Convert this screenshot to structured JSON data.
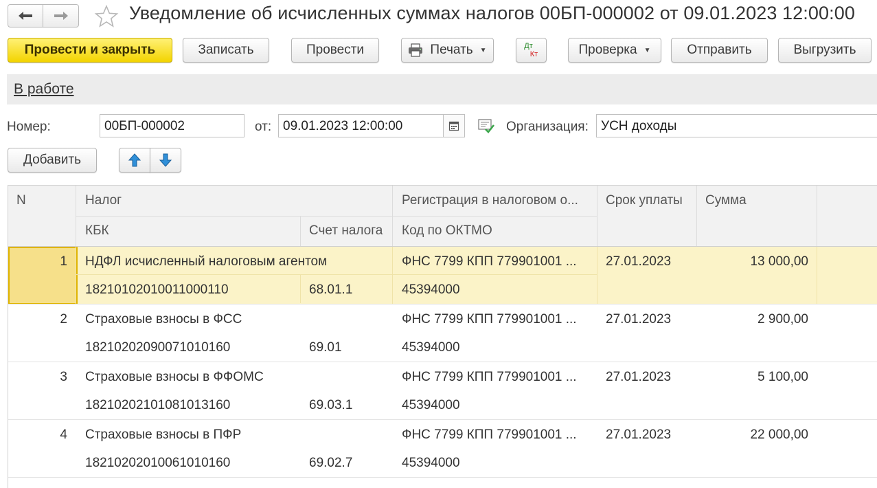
{
  "window": {
    "title": "Уведомление об исчисленных суммах налогов 00БП-000002 от 09.01.2023 12:00:00"
  },
  "toolbar": {
    "post_close": "Провести и закрыть",
    "save": "Записать",
    "post": "Провести",
    "print": "Печать",
    "dtkt_top": "Дт",
    "dtkt_bottom": "Кт",
    "check": "Проверка",
    "send": "Отправить",
    "export": "Выгрузить"
  },
  "status": "В работе",
  "form": {
    "number_label": "Номер:",
    "number_value": "00БП-000002",
    "date_label": "от:",
    "date_value": "09.01.2023 12:00:00",
    "org_label": "Организация:",
    "org_value": "УСН доходы"
  },
  "table_toolbar": {
    "add": "Добавить"
  },
  "table": {
    "headers": {
      "n": "N",
      "tax": "Налог",
      "kbk": "КБК",
      "account": "Счет налога",
      "registration": "Регистрация в налоговом о...",
      "oktmo": "Код по ОКТМО",
      "due": "Срок уплаты",
      "sum": "Сумма"
    },
    "rows": [
      {
        "n": "1",
        "tax": "НДФЛ исчисленный налоговым агентом",
        "kbk": "18210102010011000110",
        "account": "68.01.1",
        "registration": "ФНС 7799 КПП 779901001 ...",
        "oktmo": "45394000",
        "due": "27.01.2023",
        "sum": "13 000,00"
      },
      {
        "n": "2",
        "tax": "Страховые взносы в ФСС",
        "kbk": "18210202090071010160",
        "account": "69.01",
        "registration": "ФНС 7799 КПП 779901001 ...",
        "oktmo": "45394000",
        "due": "27.01.2023",
        "sum": "2 900,00"
      },
      {
        "n": "3",
        "tax": "Страховые взносы в ФФОМС",
        "kbk": "18210202101081013160",
        "account": "69.03.1",
        "registration": "ФНС 7799 КПП 779901001 ...",
        "oktmo": "45394000",
        "due": "27.01.2023",
        "sum": "5 100,00"
      },
      {
        "n": "4",
        "tax": "Страховые взносы в ПФР",
        "kbk": "18210202010061010160",
        "account": "69.02.7",
        "registration": "ФНС 7799 КПП 779901001 ...",
        "oktmo": "45394000",
        "due": "27.01.2023",
        "sum": "22 000,00"
      }
    ]
  },
  "colors": {
    "primary_button": "#f3d400",
    "selected_row": "#fbf3c8",
    "arrow_blue": "#2f8fd8",
    "check_green": "#3aa54a"
  },
  "icons": [
    "arrow-left-icon",
    "arrow-right-icon",
    "star-icon",
    "printer-icon",
    "calendar-icon",
    "check-doc-icon",
    "arrow-up-icon",
    "arrow-down-icon"
  ]
}
